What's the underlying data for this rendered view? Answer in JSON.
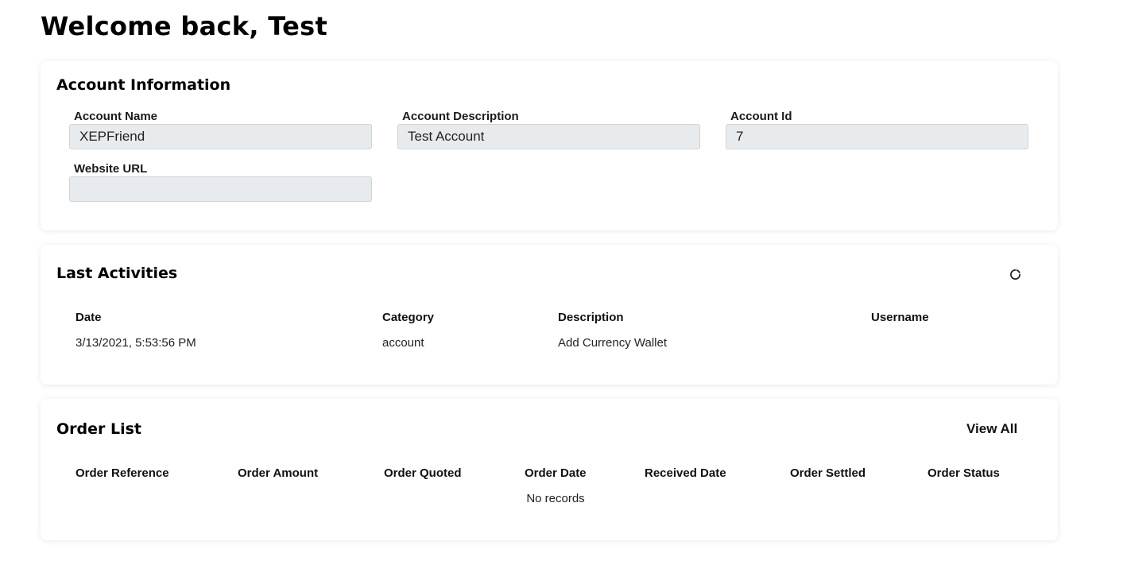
{
  "welcome": "Welcome back, Test",
  "account": {
    "title": "Account Information",
    "fields": {
      "name": {
        "label": "Account Name",
        "value": "XEPFriend"
      },
      "description": {
        "label": "Account Description",
        "value": "Test Account"
      },
      "id": {
        "label": "Account Id",
        "value": "7"
      },
      "website": {
        "label": "Website URL",
        "value": ""
      }
    }
  },
  "activities": {
    "title": "Last Activities",
    "refresh_icon": "refresh-icon",
    "columns": [
      "Date",
      "Category",
      "Description",
      "Username"
    ],
    "rows": [
      [
        "3/13/2021, 5:53:56 PM",
        "account",
        "Add Currency Wallet",
        ""
      ]
    ]
  },
  "orders": {
    "title": "Order List",
    "view_all": "View All",
    "columns": [
      "Order Reference",
      "Order Amount",
      "Order Quoted",
      "Order Date",
      "Received Date",
      "Order Settled",
      "Order Status"
    ],
    "empty": "No records"
  }
}
